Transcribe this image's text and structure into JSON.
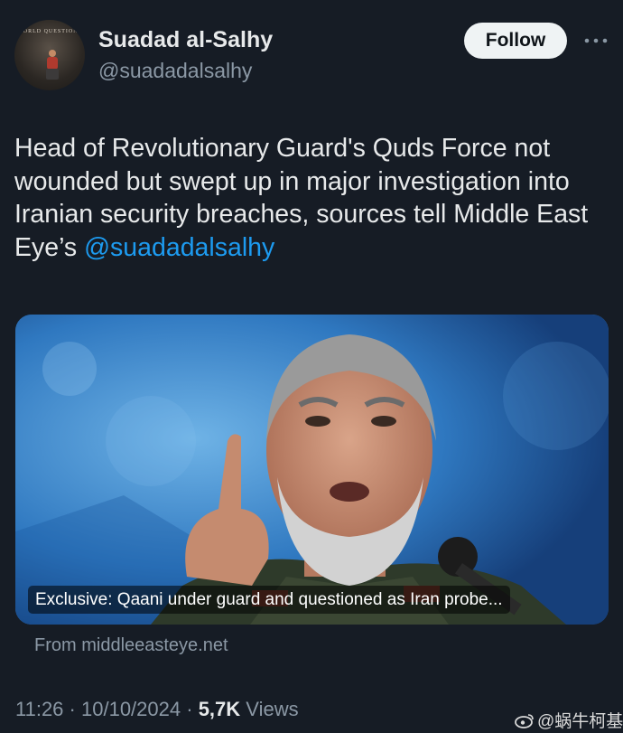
{
  "author": {
    "name": "Suadad al-Salhy",
    "handle": "@suadadalsalhy",
    "avatar_text": "WORLD QUESTIONS"
  },
  "actions": {
    "follow_label": "Follow",
    "more_icon": "more-horizontal-icon"
  },
  "tweet": {
    "text": "Head of Revolutionary Guard's Quds Force not wounded but swept up in major investigation into Iranian security breaches, sources tell Middle East Eye’s ",
    "mention": "@suadadalsalhy"
  },
  "card": {
    "caption": "Exclusive: Qaani under guard and questioned as Iran probe...",
    "source": "From middleeasteye.net"
  },
  "meta": {
    "time": "11:26",
    "separator": "·",
    "date": "10/10/2024",
    "views_count": "5,7K",
    "views_label": "Views"
  },
  "watermark": {
    "text": "@蜗牛柯基",
    "icon": "weibo-icon"
  },
  "colors": {
    "background": "#161c25",
    "accent": "#1d9bf0",
    "secondary_text": "#8b98a5"
  }
}
